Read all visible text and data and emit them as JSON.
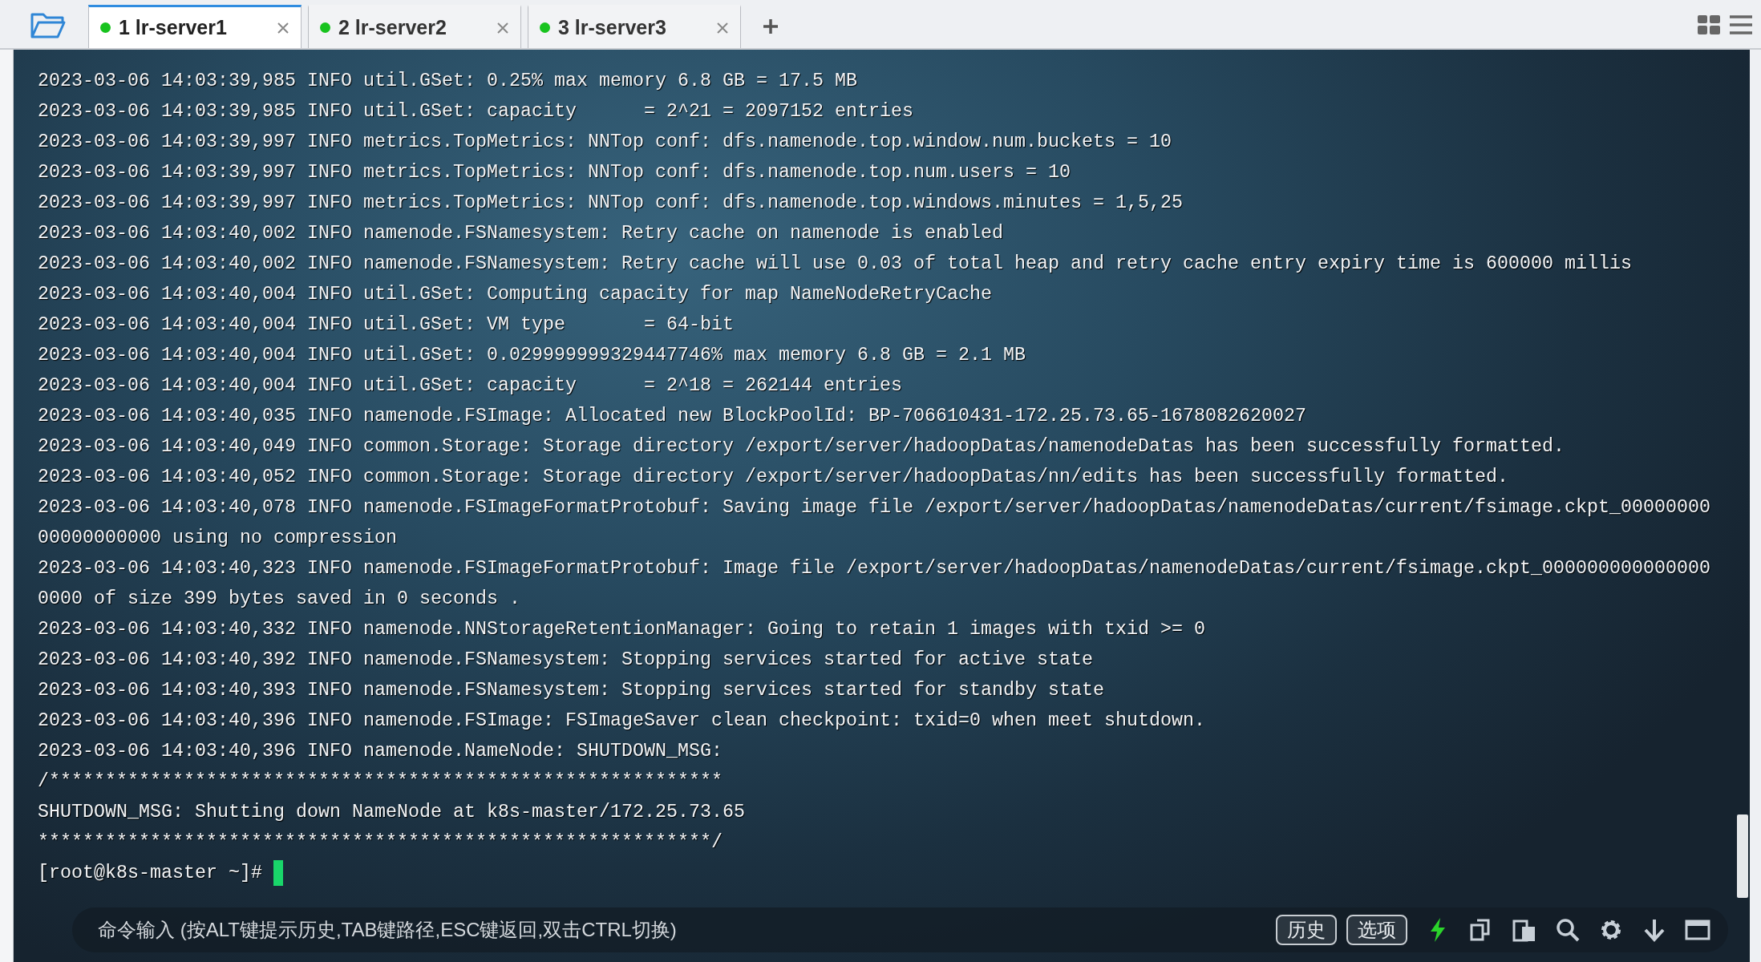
{
  "tabs": [
    {
      "label": "1 lr-server1",
      "selected": true
    },
    {
      "label": "2 lr-server2",
      "selected": false
    },
    {
      "label": "3 lr-server3",
      "selected": false
    }
  ],
  "terminal": {
    "lines": [
      "2023-03-06 14:03:39,985 INFO util.GSet: 0.25% max memory 6.8 GB = 17.5 MB",
      "2023-03-06 14:03:39,985 INFO util.GSet: capacity      = 2^21 = 2097152 entries",
      "2023-03-06 14:03:39,997 INFO metrics.TopMetrics: NNTop conf: dfs.namenode.top.window.num.buckets = 10",
      "2023-03-06 14:03:39,997 INFO metrics.TopMetrics: NNTop conf: dfs.namenode.top.num.users = 10",
      "2023-03-06 14:03:39,997 INFO metrics.TopMetrics: NNTop conf: dfs.namenode.top.windows.minutes = 1,5,25",
      "2023-03-06 14:03:40,002 INFO namenode.FSNamesystem: Retry cache on namenode is enabled",
      "2023-03-06 14:03:40,002 INFO namenode.FSNamesystem: Retry cache will use 0.03 of total heap and retry cache entry expiry time is 600000 millis",
      "2023-03-06 14:03:40,004 INFO util.GSet: Computing capacity for map NameNodeRetryCache",
      "2023-03-06 14:03:40,004 INFO util.GSet: VM type       = 64-bit",
      "2023-03-06 14:03:40,004 INFO util.GSet: 0.029999999329447746% max memory 6.8 GB = 2.1 MB",
      "2023-03-06 14:03:40,004 INFO util.GSet: capacity      = 2^18 = 262144 entries",
      "2023-03-06 14:03:40,035 INFO namenode.FSImage: Allocated new BlockPoolId: BP-706610431-172.25.73.65-1678082620027",
      "2023-03-06 14:03:40,049 INFO common.Storage: Storage directory /export/server/hadoopDatas/namenodeDatas has been successfully formatted.",
      "2023-03-06 14:03:40,052 INFO common.Storage: Storage directory /export/server/hadoopDatas/nn/edits has been successfully formatted.",
      "2023-03-06 14:03:40,078 INFO namenode.FSImageFormatProtobuf: Saving image file /export/server/hadoopDatas/namenodeDatas/current/fsimage.ckpt_00000000",
      "00000000000 using no compression",
      "2023-03-06 14:03:40,323 INFO namenode.FSImageFormatProtobuf: Image file /export/server/hadoopDatas/namenodeDatas/current/fsimage.ckpt_000000000000000",
      "0000 of size 399 bytes saved in 0 seconds .",
      "2023-03-06 14:03:40,332 INFO namenode.NNStorageRetentionManager: Going to retain 1 images with txid >= 0",
      "2023-03-06 14:03:40,392 INFO namenode.FSNamesystem: Stopping services started for active state",
      "2023-03-06 14:03:40,393 INFO namenode.FSNamesystem: Stopping services started for standby state",
      "2023-03-06 14:03:40,396 INFO namenode.FSImage: FSImageSaver clean checkpoint: txid=0 when meet shutdown.",
      "2023-03-06 14:03:40,396 INFO namenode.NameNode: SHUTDOWN_MSG:",
      "/************************************************************",
      "SHUTDOWN_MSG: Shutting down NameNode at k8s-master/172.25.73.65",
      "************************************************************/"
    ],
    "prompt": "[root@k8s-master ~]#"
  },
  "command_bar": {
    "placeholder": "命令输入 (按ALT键提示历史,TAB键路径,ESC键返回,双击CTRL切换)",
    "buttons": [
      "历史",
      "选项"
    ]
  }
}
